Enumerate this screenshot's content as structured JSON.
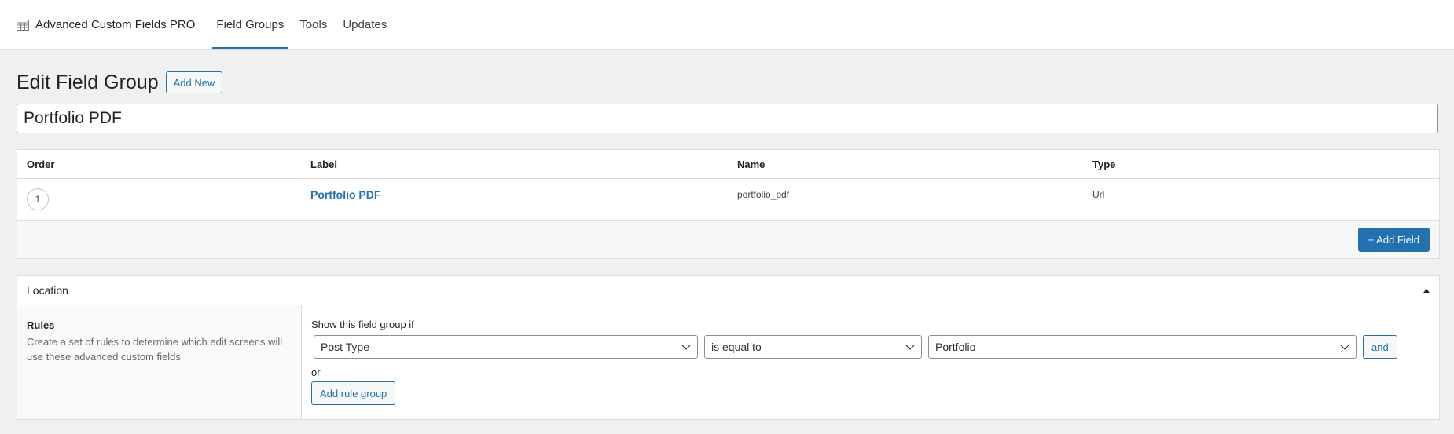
{
  "nav": {
    "brand": "Advanced Custom Fields PRO",
    "tabs": [
      {
        "label": "Field Groups",
        "active": true
      },
      {
        "label": "Tools",
        "active": false
      },
      {
        "label": "Updates",
        "active": false
      }
    ]
  },
  "header": {
    "title": "Edit Field Group",
    "add_new_label": "Add New"
  },
  "field_group_title": "Portfolio PDF",
  "fields_table": {
    "headers": {
      "order": "Order",
      "label": "Label",
      "name": "Name",
      "type": "Type"
    },
    "rows": [
      {
        "order": "1",
        "label": "Portfolio PDF",
        "name": "portfolio_pdf",
        "type": "Url"
      }
    ],
    "add_field_label": "+ Add Field"
  },
  "location": {
    "title": "Location",
    "rules_title": "Rules",
    "rules_desc": "Create a set of rules to determine which edit screens will use these advanced custom fields",
    "show_if_label": "Show this field group if",
    "rule": {
      "param": "Post Type",
      "operator": "is equal to",
      "value": "Portfolio"
    },
    "and_label": "and",
    "or_label": "or",
    "add_rule_group_label": "Add rule group"
  },
  "colors": {
    "accent": "#2271b1",
    "background": "#f0f0f1"
  }
}
